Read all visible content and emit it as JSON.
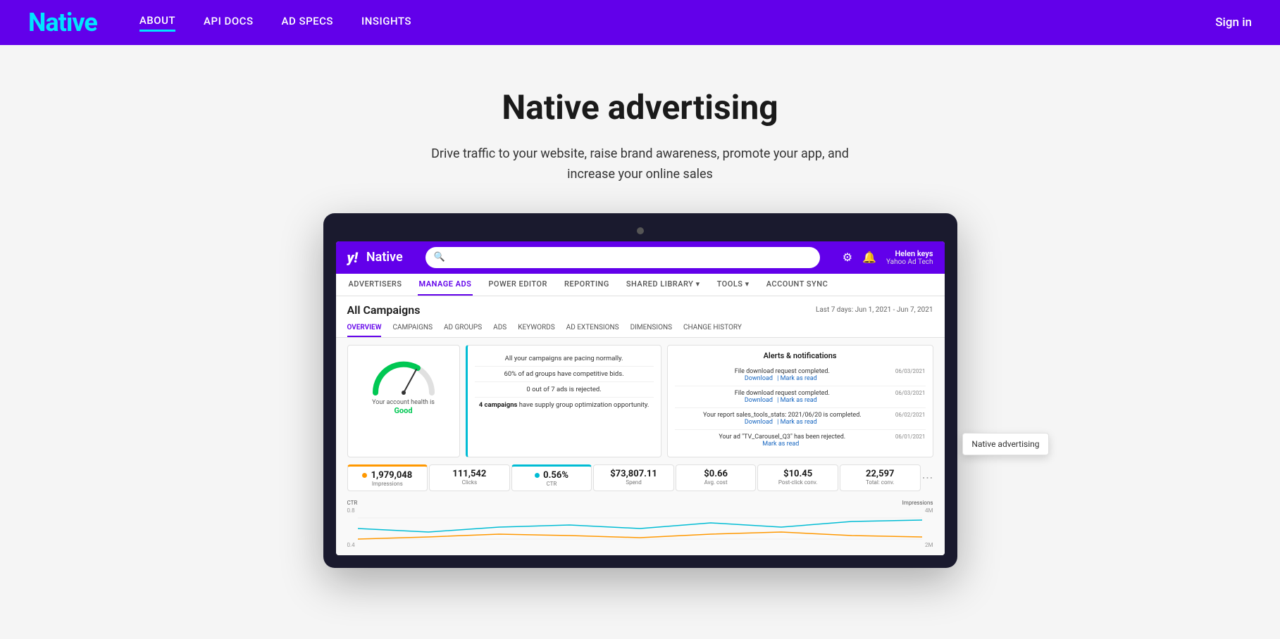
{
  "header": {
    "logo": "Native",
    "nav": [
      {
        "label": "ABOUT",
        "active": true
      },
      {
        "label": "API DOCS",
        "active": false
      },
      {
        "label": "AD SPECS",
        "active": false
      },
      {
        "label": "INSIGHTS",
        "active": false
      }
    ],
    "signin": "Sign in"
  },
  "hero": {
    "title": "Native advertising",
    "subtitle": "Drive traffic to your website, raise brand awareness, promote your app, and increase your online sales"
  },
  "app": {
    "logo_y": "y!",
    "logo_text": "Native",
    "user_name": "Helen keys",
    "user_sub": "Yahoo Ad Tech",
    "nav_items": [
      {
        "label": "ADVERTISERS",
        "active": false
      },
      {
        "label": "MANAGE ADS",
        "active": true
      },
      {
        "label": "POWER EDITOR",
        "active": false
      },
      {
        "label": "REPORTING",
        "active": false
      },
      {
        "label": "SHARED LIBRARY ▾",
        "active": false
      },
      {
        "label": "TOOLS ▾",
        "active": false
      },
      {
        "label": "ACCOUNT SYNC",
        "active": false
      }
    ],
    "campaign_title": "All Campaigns",
    "date_range": "Last 7 days: Jun 1, 2021 - Jun 7, 2021",
    "tabs": [
      {
        "label": "OVERVIEW",
        "active": true
      },
      {
        "label": "CAMPAIGNS",
        "active": false
      },
      {
        "label": "AD GROUPS",
        "active": false
      },
      {
        "label": "ADS",
        "active": false
      },
      {
        "label": "KEYWORDS",
        "active": false
      },
      {
        "label": "AD EXTENSIONS",
        "active": false
      },
      {
        "label": "DIMENSIONS",
        "active": false
      },
      {
        "label": "CHANGE HISTORY",
        "active": false
      }
    ],
    "health_label": "Your account health is",
    "health_value": "Good",
    "alerts": [
      {
        "text": "All your campaigns are pacing normally."
      },
      {
        "text": "60% of ad groups have competitive bids."
      },
      {
        "text": "0 out of 7 ads is rejected."
      },
      {
        "text": "4 campaigns have supply group optimization opportunity."
      }
    ],
    "notifications_title": "Alerts & notifications",
    "notifications": [
      {
        "text": "File download request completed.",
        "links": "Download | Mark as read",
        "date": "06/03/2021"
      },
      {
        "text": "File download request completed.",
        "links": "Download | Mark as read",
        "date": "06/03/2021"
      },
      {
        "text": "Your report sales_tools_stats: 2021/06/20 is completed.",
        "links": "Download | Mark as read",
        "date": "06/02/2021"
      },
      {
        "text": "Your ad \"TV_Carousel_Q3\" has been rejected.",
        "links": "Mark as read",
        "date": "06/01/2021"
      }
    ],
    "metrics": [
      {
        "label": "Impressions",
        "value": "1,979,048",
        "dot_color": "#ff9800",
        "active": true
      },
      {
        "label": "Clicks",
        "value": "111,542",
        "dot_color": null,
        "active": false
      },
      {
        "label": "CTR",
        "value": "0.56%",
        "dot_color": "#00bcd4",
        "active2": true
      },
      {
        "label": "Spend",
        "value": "$73,807.11",
        "dot_color": null,
        "active": false
      },
      {
        "label": "Avg. cost",
        "value": "$0.66",
        "dot_color": null,
        "active": false
      },
      {
        "label": "Post-click conv.",
        "value": "$10.45",
        "dot_color": null,
        "active": false
      },
      {
        "label": "Total: conv.",
        "value": "22,597",
        "dot_color": null,
        "active": false
      }
    ],
    "chart_left_label": "CTR",
    "chart_right_label": "Impressions",
    "chart_y_left": [
      "0.8",
      "0.4"
    ],
    "chart_y_right": [
      "4M",
      "2M"
    ]
  },
  "tooltip": {
    "text": "Native advertising"
  }
}
